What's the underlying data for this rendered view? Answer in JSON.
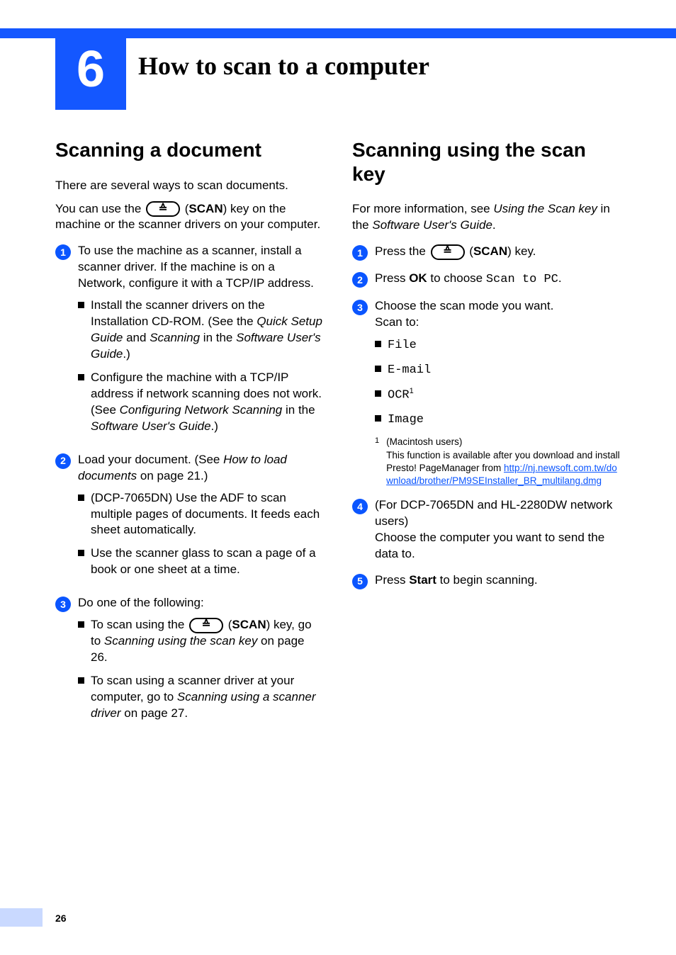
{
  "chapter": {
    "number": "6",
    "title": "How to scan to a computer"
  },
  "left": {
    "heading": "Scanning a document",
    "intro1": "There are several ways to scan documents.",
    "intro2a": "You can use the ",
    "intro2b": " (",
    "intro2_scan": "SCAN",
    "intro2c": ") key on the machine or the scanner drivers on your computer.",
    "step1": "To use the machine as a scanner, install a scanner driver. If the machine is on a Network, configure it with a TCP/IP address.",
    "step1_b1a": "Install the scanner drivers on the Installation CD-ROM. (See the ",
    "step1_b1b": "Quick Setup Guide",
    "step1_b1c": " and ",
    "step1_b1d": "Scanning",
    "step1_b1e": " in the ",
    "step1_b1f": "Software User's Guide",
    "step1_b1g": ".)",
    "step1_b2a": "Configure the machine with a TCP/IP address if network scanning does not work. (See ",
    "step1_b2b": "Configuring Network Scanning",
    "step1_b2c": " in the ",
    "step1_b2d": "Software User's Guide",
    "step1_b2e": ".)",
    "step2a": "Load your document. (See ",
    "step2b": "How to load documents",
    "step2c": " on page 21.)",
    "step2_b1": "(DCP-7065DN) Use the ADF to scan multiple pages of documents. It feeds each sheet automatically.",
    "step2_b2": "Use the scanner glass to scan a page of a book or one sheet at a time.",
    "step3": "Do one of the following:",
    "step3_b1a": "To scan using the ",
    "step3_b1b": " (",
    "step3_b1_scan": "SCAN",
    "step3_b1c": ") key, go to ",
    "step3_b1d": "Scanning using the scan key",
    "step3_b1e": " on page 26.",
    "step3_b2a": "To scan using a scanner driver at your computer, go to ",
    "step3_b2b": "Scanning using a scanner driver",
    "step3_b2c": " on page 27."
  },
  "right": {
    "heading": "Scanning using the scan key",
    "intro_a": "For more information, see ",
    "intro_b": "Using the Scan key",
    "intro_c": " in the ",
    "intro_d": "Software User's Guide",
    "intro_e": ".",
    "s1a": "Press the ",
    "s1b": " (",
    "s1_scan": "SCAN",
    "s1c": ") key.",
    "s2a": "Press ",
    "s2_ok": "OK",
    "s2b": " to choose ",
    "s2_menu": "Scan to PC",
    "s2c": ".",
    "s3a": "Choose the scan mode you want.",
    "s3b": "Scan to:",
    "opt_file": "File",
    "opt_email": "E-mail",
    "opt_ocr": "OCR",
    "opt_ocr_sup": "1",
    "opt_image": "Image",
    "fn_mark": "1",
    "fn_a": "(Macintosh users)",
    "fn_b": "This function is available after you download and install Presto! PageManager from ",
    "fn_link": "http://nj.newsoft.com.tw/download/brother/PM9SEInstaller_BR_multilang.dmg",
    "s4a": "(For DCP-7065DN and HL-2280DW network users)",
    "s4b": "Choose the computer you want to send the data to.",
    "s5a": "Press ",
    "s5_start": "Start",
    "s5b": " to begin scanning."
  },
  "page_number": "26"
}
